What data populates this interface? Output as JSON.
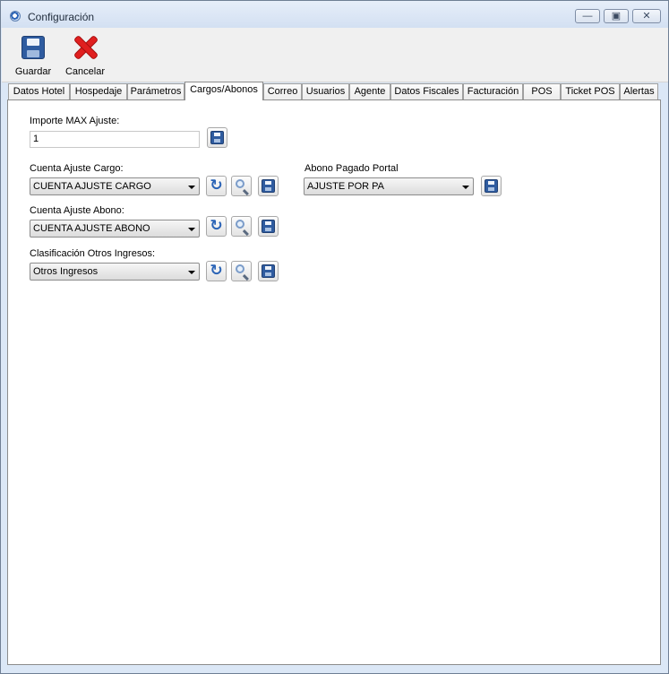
{
  "window": {
    "title": "Configuración"
  },
  "toolbar": {
    "save_label": "Guardar",
    "cancel_label": "Cancelar"
  },
  "tabs": [
    "Datos Hotel",
    "Hospedaje",
    "Parámetros",
    "Cargos/Abonos",
    "Correo",
    "Usuarios",
    "Agente",
    "Datos Fiscales",
    "Facturación",
    "POS",
    "Ticket POS",
    "Alertas"
  ],
  "active_tab": "Cargos/Abonos",
  "form": {
    "importe_max": {
      "label": "Importe MAX Ajuste:",
      "value": "1"
    },
    "cuenta_cargo": {
      "label": "Cuenta Ajuste Cargo:",
      "value": "CUENTA AJUSTE CARGO"
    },
    "cuenta_abono": {
      "label": "Cuenta Ajuste Abono:",
      "value": "CUENTA AJUSTE ABONO"
    },
    "clasificacion": {
      "label": "Clasificación Otros Ingresos:",
      "value": "Otros Ingresos"
    },
    "abono_portal": {
      "label": "Abono Pagado Portal",
      "value": "AJUSTE POR PA"
    }
  },
  "icons": {
    "app": "app-icon",
    "save": "floppy-disk-icon",
    "cancel": "red-x-icon",
    "refresh": "refresh-icon",
    "search": "magnifier-icon"
  }
}
